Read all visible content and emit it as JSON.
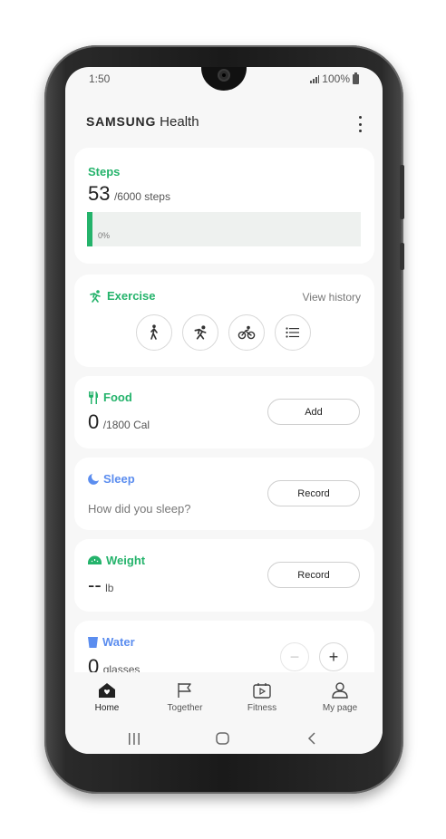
{
  "status": {
    "time": "1:50",
    "battery": "100%"
  },
  "appbar": {
    "brand": "SAMSUNG",
    "product": "Health"
  },
  "steps": {
    "title": "Steps",
    "count": "53",
    "goal": "/6000 steps",
    "progress_label": "0%",
    "progress_fraction": 0.01
  },
  "exercise": {
    "title": "Exercise",
    "history_label": "View history",
    "buttons": [
      "walking-icon",
      "running-icon",
      "cycling-icon",
      "list-icon"
    ]
  },
  "food": {
    "title": "Food",
    "value": "0",
    "goal": "/1800 Cal",
    "button": "Add"
  },
  "sleep": {
    "title": "Sleep",
    "prompt": "How did you sleep?",
    "button": "Record"
  },
  "weight": {
    "title": "Weight",
    "value": "--",
    "unit": "lb",
    "button": "Record"
  },
  "water": {
    "title": "Water",
    "value": "0",
    "unit": "glasses",
    "minus": "−",
    "plus": "+"
  },
  "nav": {
    "items": [
      {
        "label": "Home",
        "icon": "home-icon"
      },
      {
        "label": "Together",
        "icon": "flag-icon"
      },
      {
        "label": "Fitness",
        "icon": "fitness-icon"
      },
      {
        "label": "My page",
        "icon": "person-icon"
      }
    ]
  },
  "colors": {
    "accent_green": "#24b36b",
    "accent_blue": "#5b8def"
  }
}
